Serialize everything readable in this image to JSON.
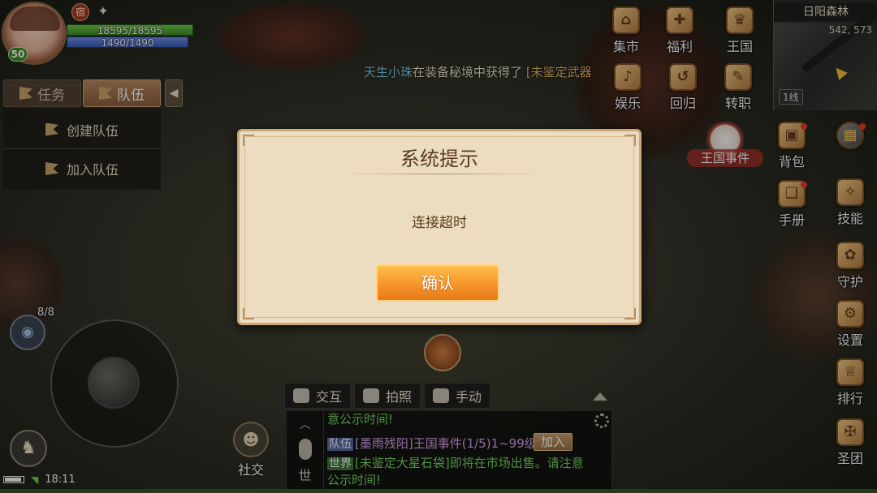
{
  "player": {
    "level": "50",
    "hp": "18595/18595",
    "mp": "1490/1490",
    "buff_1": "宿"
  },
  "tabs": {
    "task": "任务",
    "team": "队伍"
  },
  "team_panel": {
    "create": "创建队伍",
    "join": "加入队伍"
  },
  "minimap": {
    "name": "日阳森林",
    "coords": "542, 573",
    "line": "1线"
  },
  "notice": {
    "player": "天生小珠",
    "text": "在装备秘境中获得了",
    "item": "[未鉴定武器"
  },
  "menu": {
    "market": "集市",
    "welfare": "福利",
    "kingdom": "王国",
    "entertainment": "娱乐",
    "return": "回归",
    "job_change": "转职",
    "kingdom_event": "王国事件",
    "bag": "背包",
    "handbook": "手册",
    "skill": "技能",
    "guard": "守护",
    "settings": "设置",
    "ranking": "排行",
    "holy_group": "圣团"
  },
  "controls": {
    "eye_count": "8/8",
    "time": "18:11"
  },
  "social": {
    "label": "社交"
  },
  "chat": {
    "tool_interact": "交互",
    "tool_photo": "拍照",
    "tool_manual": "手动",
    "channel": "世",
    "msg0": "意公示时间!",
    "msg1_tag": "队伍",
    "msg1_name": "[墨雨残阳]",
    "msg1_event": "王国事件(1/5)1~99级",
    "join_button": "加入",
    "msg2_tag": "世界",
    "msg2_text": "[未鉴定大星石袋]即将在市场出售。请注意公示时间!"
  },
  "modal": {
    "title": "系统提示",
    "message": "连接超时",
    "confirm": "确认"
  }
}
